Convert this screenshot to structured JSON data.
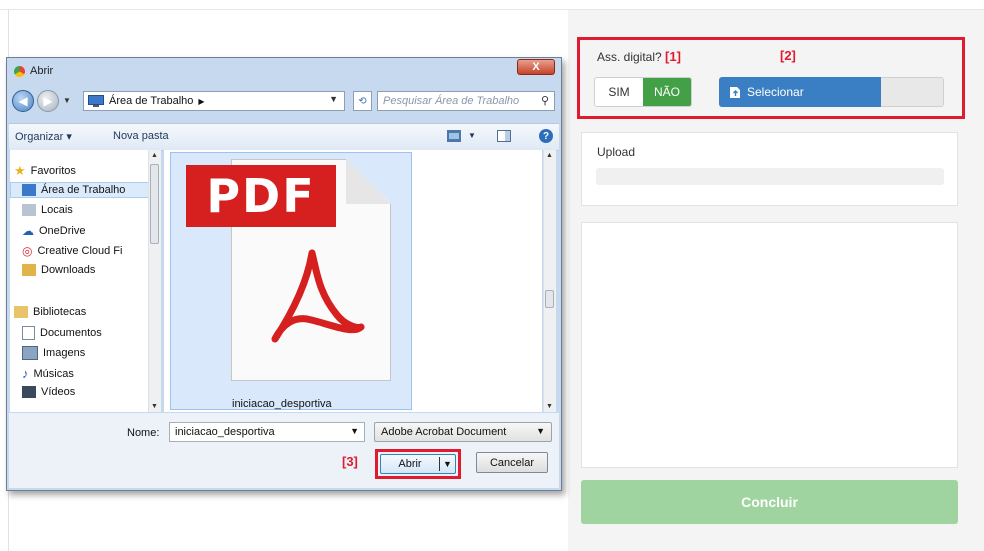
{
  "form": {
    "assinatura_label": "Ass. digital?",
    "marker_1": "[1]",
    "marker_2": "[2]",
    "marker_3": "[3]",
    "toggle": {
      "sim": "SIM",
      "nao": "NÃO",
      "selected": "NÃO"
    },
    "select_button": "Selecionar",
    "upload_label": "Upload",
    "upload_progress": 0,
    "concluir_button": "Concluir"
  },
  "colors": {
    "marker_red": "#e01b2f",
    "toggle_green": "#43a047",
    "select_blue": "#3a7fc3",
    "concluir_green": "#9fd39f"
  },
  "dialog": {
    "title": "Abrir",
    "close_label": "X",
    "address_path": "Área de Trabalho",
    "search_placeholder": "Pesquisar Área de Trabalho",
    "toolbar": {
      "organize": "Organizar ▾",
      "new_folder": "Nova pasta"
    },
    "nav": {
      "favorites": "Favoritos",
      "items": [
        "Área de Trabalho",
        "Locais",
        "OneDrive",
        "Creative Cloud Fi",
        "Downloads"
      ],
      "libraries": "Bibliotecas",
      "library_items": [
        "Documentos",
        "Imagens",
        "Músicas",
        "Vídeos"
      ],
      "selected": "Área de Trabalho"
    },
    "file": {
      "icon_text": "PDF",
      "name": "iniciacao_desportiva"
    },
    "filename_label": "Nome:",
    "filename_value": "iniciacao_desportiva",
    "filetype": "Adobe Acrobat Document",
    "open_button": "Abrir",
    "cancel_button": "Cancelar"
  }
}
